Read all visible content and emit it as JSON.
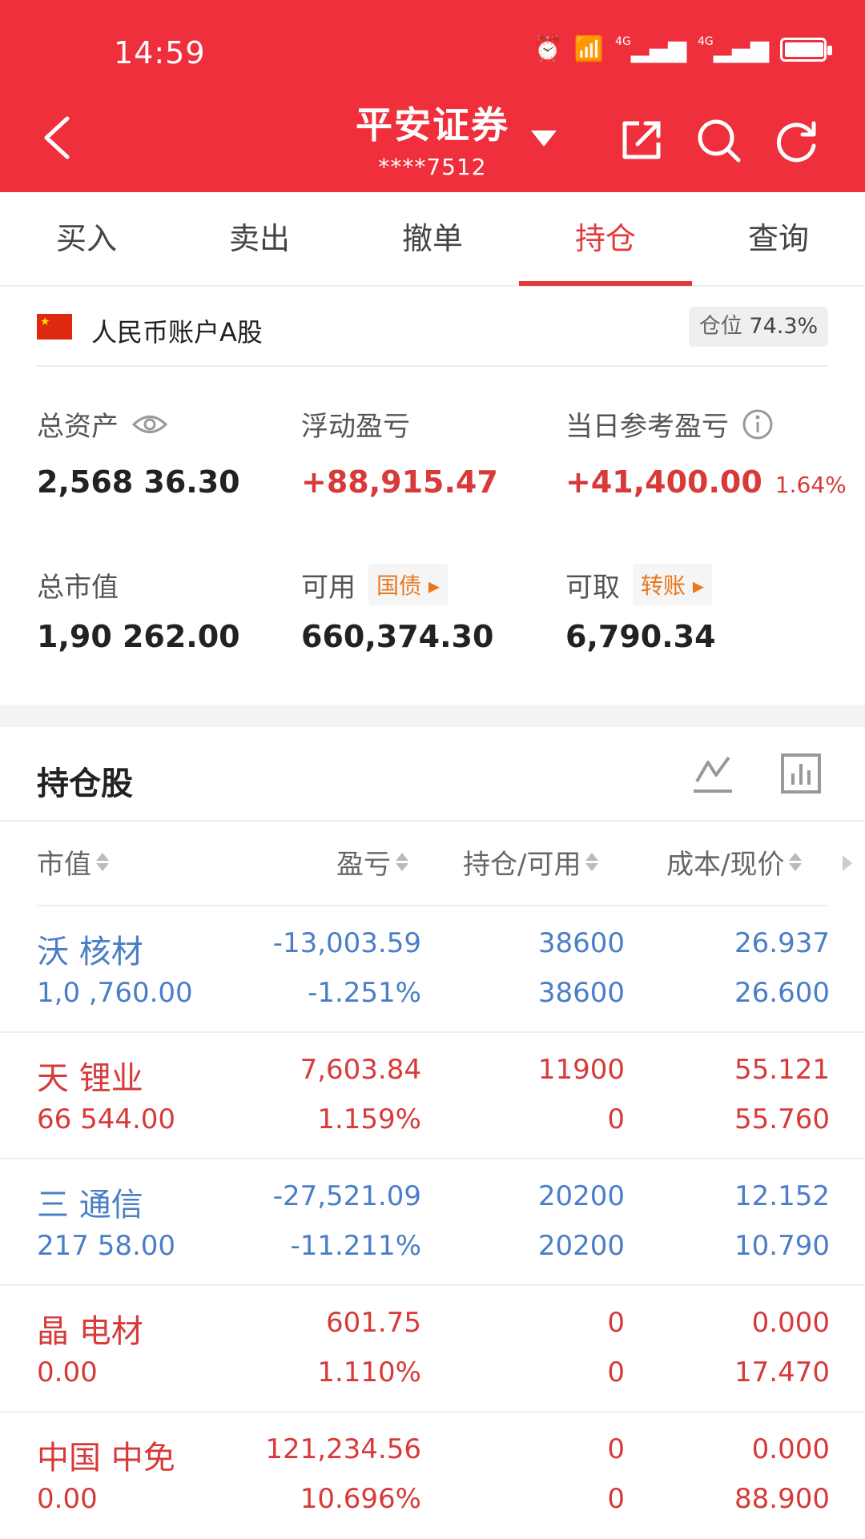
{
  "status_bar": {
    "time": "14:59",
    "network_1": "4G",
    "network_2": "4G"
  },
  "header": {
    "title": "平安证券",
    "subtitle": "****7512"
  },
  "tabs": [
    {
      "label": "买入"
    },
    {
      "label": "卖出"
    },
    {
      "label": "撤单"
    },
    {
      "label": "持仓"
    },
    {
      "label": "查询"
    }
  ],
  "account": {
    "label": "人民币账户A股",
    "position_label": "仓位",
    "position_value": "74.3%"
  },
  "metrics": {
    "total_assets_label": "总资产",
    "total_assets": "2,568 36.30",
    "floating_pl_label": "浮动盈亏",
    "floating_pl": "+88,915.47",
    "daily_pl_label": "当日参考盈亏",
    "daily_pl": "+41,400.00",
    "daily_pl_pct": "1.64%",
    "market_value_label": "总市值",
    "market_value": "1,90 262.00",
    "available_label": "可用",
    "available_tag": "国债",
    "available": "660,374.30",
    "withdrawable_label": "可取",
    "withdrawable_tag": "转账",
    "withdrawable": "6,790.34"
  },
  "holdings": {
    "title": "持仓股",
    "columns": [
      "市值",
      "盈亏",
      "持仓/可用",
      "成本/现价"
    ],
    "rows": [
      {
        "name": "沃 核材",
        "market_value": "1,0 ,760.00",
        "pl": "-13,003.59",
        "pl_pct": "-1.251%",
        "position": "38600",
        "available": "38600",
        "cost": "26.937",
        "price": "26.600",
        "color": "#4a7ec7"
      },
      {
        "name": "天 锂业",
        "market_value": "66 544.00",
        "pl": "7,603.84",
        "pl_pct": "1.159%",
        "position": "11900",
        "available": "0",
        "cost": "55.121",
        "price": "55.760",
        "color": "#d83a3a"
      },
      {
        "name": "三 通信",
        "market_value": "217 58.00",
        "pl": "-27,521.09",
        "pl_pct": "-11.211%",
        "position": "20200",
        "available": "20200",
        "cost": "12.152",
        "price": "10.790",
        "color": "#4a7ec7"
      },
      {
        "name": "晶 电材",
        "market_value": "0.00",
        "pl": "601.75",
        "pl_pct": "1.110%",
        "position": "0",
        "available": "0",
        "cost": "0.000",
        "price": "17.470",
        "color": "#d83a3a"
      },
      {
        "name": "中国 中免",
        "market_value": "0.00",
        "pl": "121,234.56",
        "pl_pct": "10.696%",
        "position": "0",
        "available": "0",
        "cost": "0.000",
        "price": "88.900",
        "color": "#d83a3a"
      }
    ]
  },
  "colors": {
    "header_red": "#ef2f3b",
    "gain_red": "#d83a3a",
    "loss_blue": "#4a7ec7",
    "tag_orange": "#e8781e"
  }
}
